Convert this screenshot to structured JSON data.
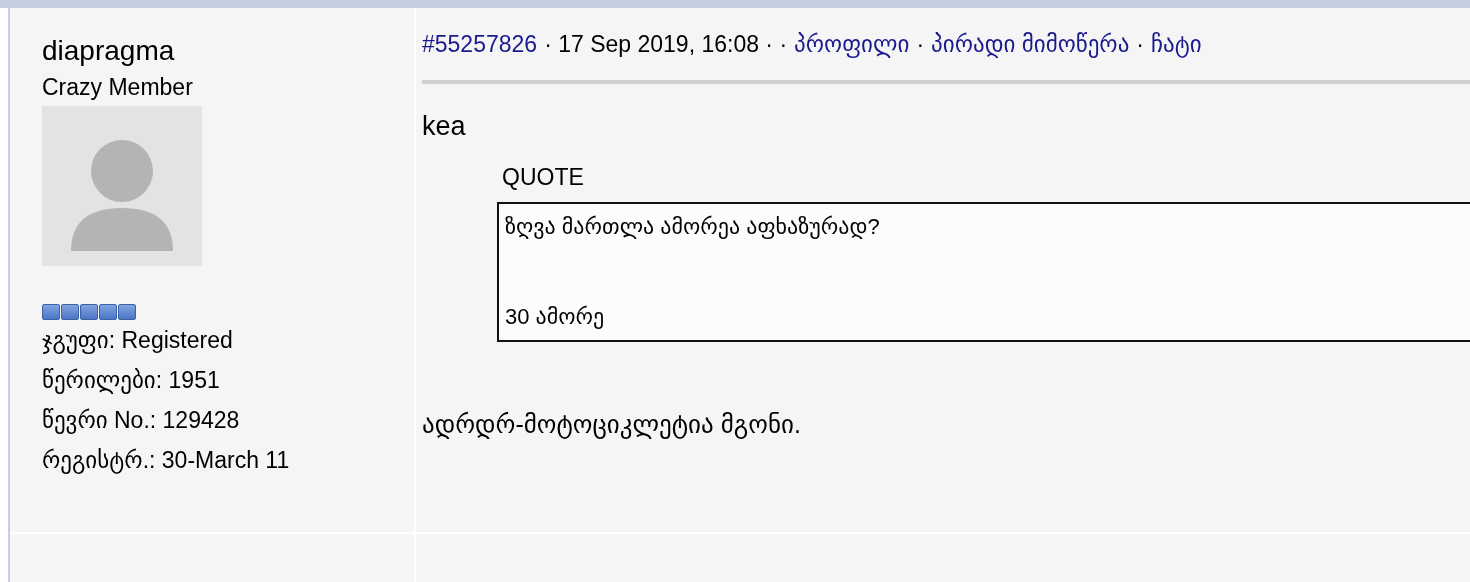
{
  "author": {
    "name": "diapragma",
    "rank": "Crazy Member",
    "avatar": {
      "kind": "placeholder"
    },
    "stars": 5,
    "details": [
      {
        "label": "ჯგუფი:",
        "value": "Registered"
      },
      {
        "label": "წერილები:",
        "value": "1951"
      },
      {
        "label": "წევრი No.:",
        "value": "129428"
      },
      {
        "label": "რეგისტრ.:",
        "value": "30-March 11"
      }
    ]
  },
  "post": {
    "header": [
      {
        "kind": "link",
        "text": "#55257826"
      },
      {
        "kind": "text",
        "text": "· 17 Sep 2019, 16:08 · ·"
      },
      {
        "kind": "link",
        "text": "პროფილი"
      },
      {
        "kind": "text",
        "text": "·"
      },
      {
        "kind": "link",
        "text": "პირადი მიმოწერა"
      },
      {
        "kind": "text",
        "text": "·"
      },
      {
        "kind": "link",
        "text": "ჩატი"
      }
    ],
    "greeting": "kea",
    "quote": {
      "label": "QUOTE",
      "lines": [
        "ზღვა მართლა ამორეა აფხაზურად?",
        "30 ამორე"
      ]
    },
    "body": "ადრდრ-მოტოციკლეტია მგონი."
  }
}
